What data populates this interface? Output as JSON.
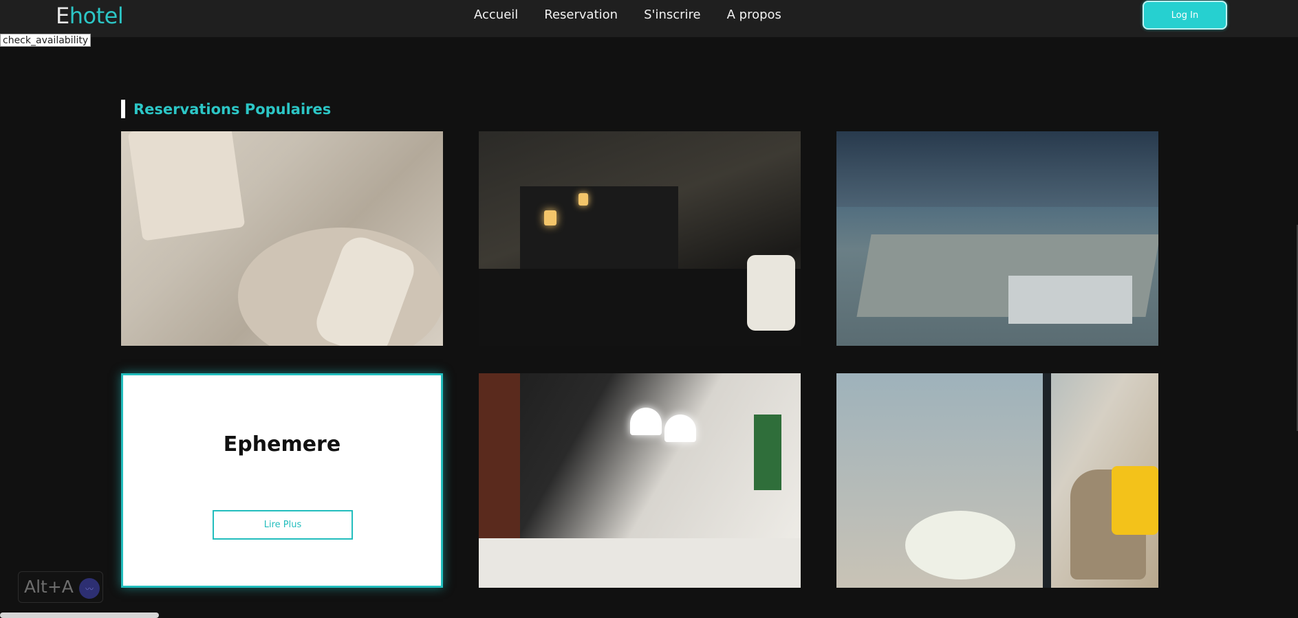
{
  "navbar": {
    "logo_prefix": "E",
    "logo_suffix": "hotel",
    "links": [
      "Accueil",
      "Reservation",
      "S'inscrire",
      "A propos"
    ],
    "login_label": "Log In"
  },
  "broken_image_alt": "check_availability",
  "section": {
    "title": "Reservations Populaires"
  },
  "cards": {
    "featured": {
      "title": "Ephemere",
      "button_label": "Lire Plus"
    }
  },
  "widget": {
    "label": "Alt+A"
  },
  "colors": {
    "accent": "#26d0d0",
    "background": "#111111",
    "navbar": "#1f1f1f"
  }
}
